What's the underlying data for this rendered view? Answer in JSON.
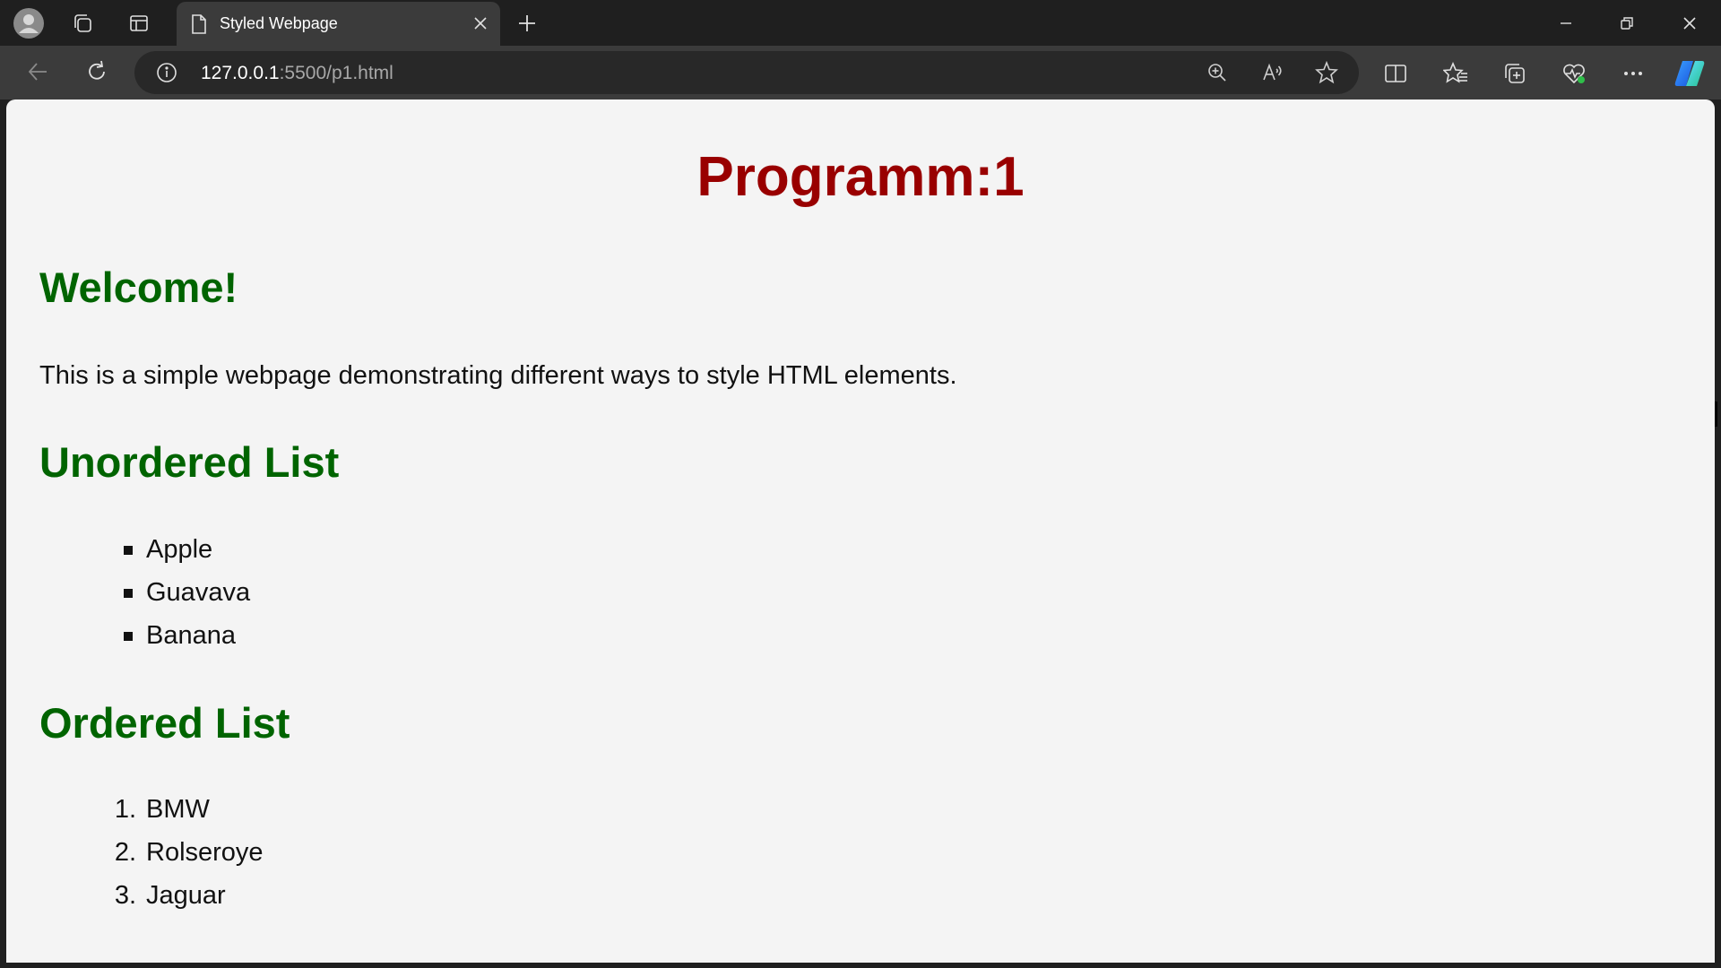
{
  "browser": {
    "tab": {
      "title": "Styled Webpage",
      "icon": "page-icon"
    },
    "address": {
      "host": "127.0.0.1",
      "rest": ":5500/p1.html"
    },
    "icons": {
      "profile": "profile-avatar-icon",
      "workspaces": "workspaces-icon",
      "tab_actions": "vertical-tabs-icon",
      "new_tab": "plus-icon",
      "minimize": "minimize-icon",
      "restore": "restore-icon",
      "close": "close-icon",
      "back": "back-arrow-icon",
      "refresh": "refresh-icon",
      "site_info": "info-icon",
      "zoom": "zoom-in-icon",
      "read_aloud": "read-aloud-icon",
      "favorite": "star-icon",
      "split_screen": "split-screen-icon",
      "favorites": "favorites-icon",
      "collections": "collections-icon",
      "browser_essentials": "heart-pulse-icon",
      "more": "more-dots-icon",
      "copilot": "copilot-icon"
    }
  },
  "page": {
    "heading": "Programm:1",
    "welcome": "Welcome!",
    "intro": "This is a simple webpage demonstrating different ways to style HTML elements.",
    "unordered": {
      "title": "Unordered List",
      "items": [
        "Apple",
        "Guavava",
        "Banana"
      ]
    },
    "ordered": {
      "title": "Ordered List",
      "items": [
        {
          "marker": "1.",
          "label": "BMW"
        },
        {
          "marker": "2.",
          "label": "Rolseroye"
        },
        {
          "marker": "3.",
          "label": "Jaguar"
        }
      ]
    }
  },
  "colors": {
    "heading": "#990000",
    "subheading": "#006400",
    "page_background": "#f4f4f4",
    "chrome_dark": "#1f1f1f",
    "toolbar": "#3b3b3b"
  }
}
